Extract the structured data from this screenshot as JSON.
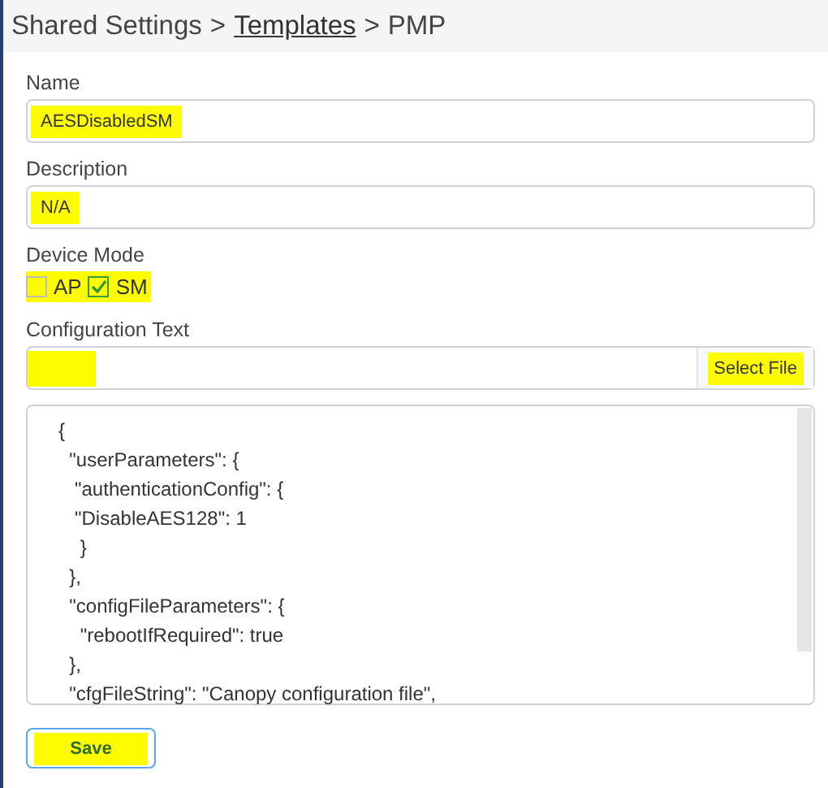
{
  "breadcrumb": [
    {
      "label": "Shared Settings",
      "link": false
    },
    {
      "label": "Templates",
      "link": true
    },
    {
      "label": "PMP",
      "link": false
    }
  ],
  "breadcrumb_separator": ">",
  "name": {
    "label": "Name",
    "value": "AESDisabledSM",
    "highlighted": true
  },
  "description": {
    "label": "Description",
    "value": "N/A",
    "highlighted": true
  },
  "device_mode": {
    "label": "Device Mode",
    "highlighted": true,
    "options": [
      {
        "label": "AP",
        "checked": false
      },
      {
        "label": "SM",
        "checked": true
      }
    ]
  },
  "configuration_text": {
    "label": "Configuration Text",
    "highlighted": true,
    "button": {
      "label": "Select File",
      "highlighted": true
    }
  },
  "config_lines": [
    "{",
    "  \"userParameters\": {",
    "   \"authenticationConfig\": {",
    "   \"DisableAES128\": 1",
    "    }",
    "  },",
    "  \"configFileParameters\": {",
    "    \"rebootIfRequired\": true",
    "  },",
    "  \"cfgFileString\": \"Canopy configuration file\","
  ],
  "save": {
    "label": "Save",
    "highlighted": true
  }
}
